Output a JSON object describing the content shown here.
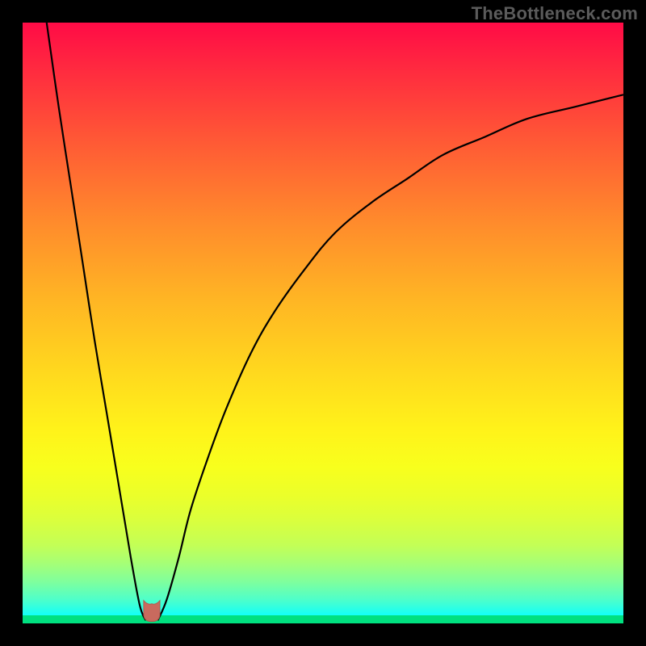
{
  "watermark": "TheBottleneck.com",
  "colors": {
    "curve_stroke": "#000000",
    "marker_fill": "#c96a5e",
    "baseline": "#00e080"
  },
  "chart_data": {
    "type": "line",
    "title": "",
    "xlabel": "",
    "ylabel": "",
    "xlim": [
      0,
      100
    ],
    "ylim": [
      0,
      100
    ],
    "grid": false,
    "minimum_x": 21,
    "series": [
      {
        "name": "left-branch",
        "x": [
          4,
          6,
          8,
          10,
          12,
          14,
          16,
          18,
          19.5,
          20.5
        ],
        "values": [
          100,
          86,
          73,
          60,
          47,
          35,
          23,
          11,
          3,
          0.5
        ]
      },
      {
        "name": "right-branch",
        "x": [
          22.5,
          24,
          26,
          28,
          31,
          34,
          38,
          42,
          47,
          52,
          58,
          64,
          70,
          77,
          84,
          92,
          100
        ],
        "values": [
          0.5,
          4,
          11,
          19,
          28,
          36,
          45,
          52,
          59,
          65,
          70,
          74,
          78,
          81,
          84,
          86,
          88
        ]
      }
    ],
    "marker": {
      "name": "minimum",
      "x_range": [
        20,
        23
      ],
      "y": 1.5
    }
  }
}
